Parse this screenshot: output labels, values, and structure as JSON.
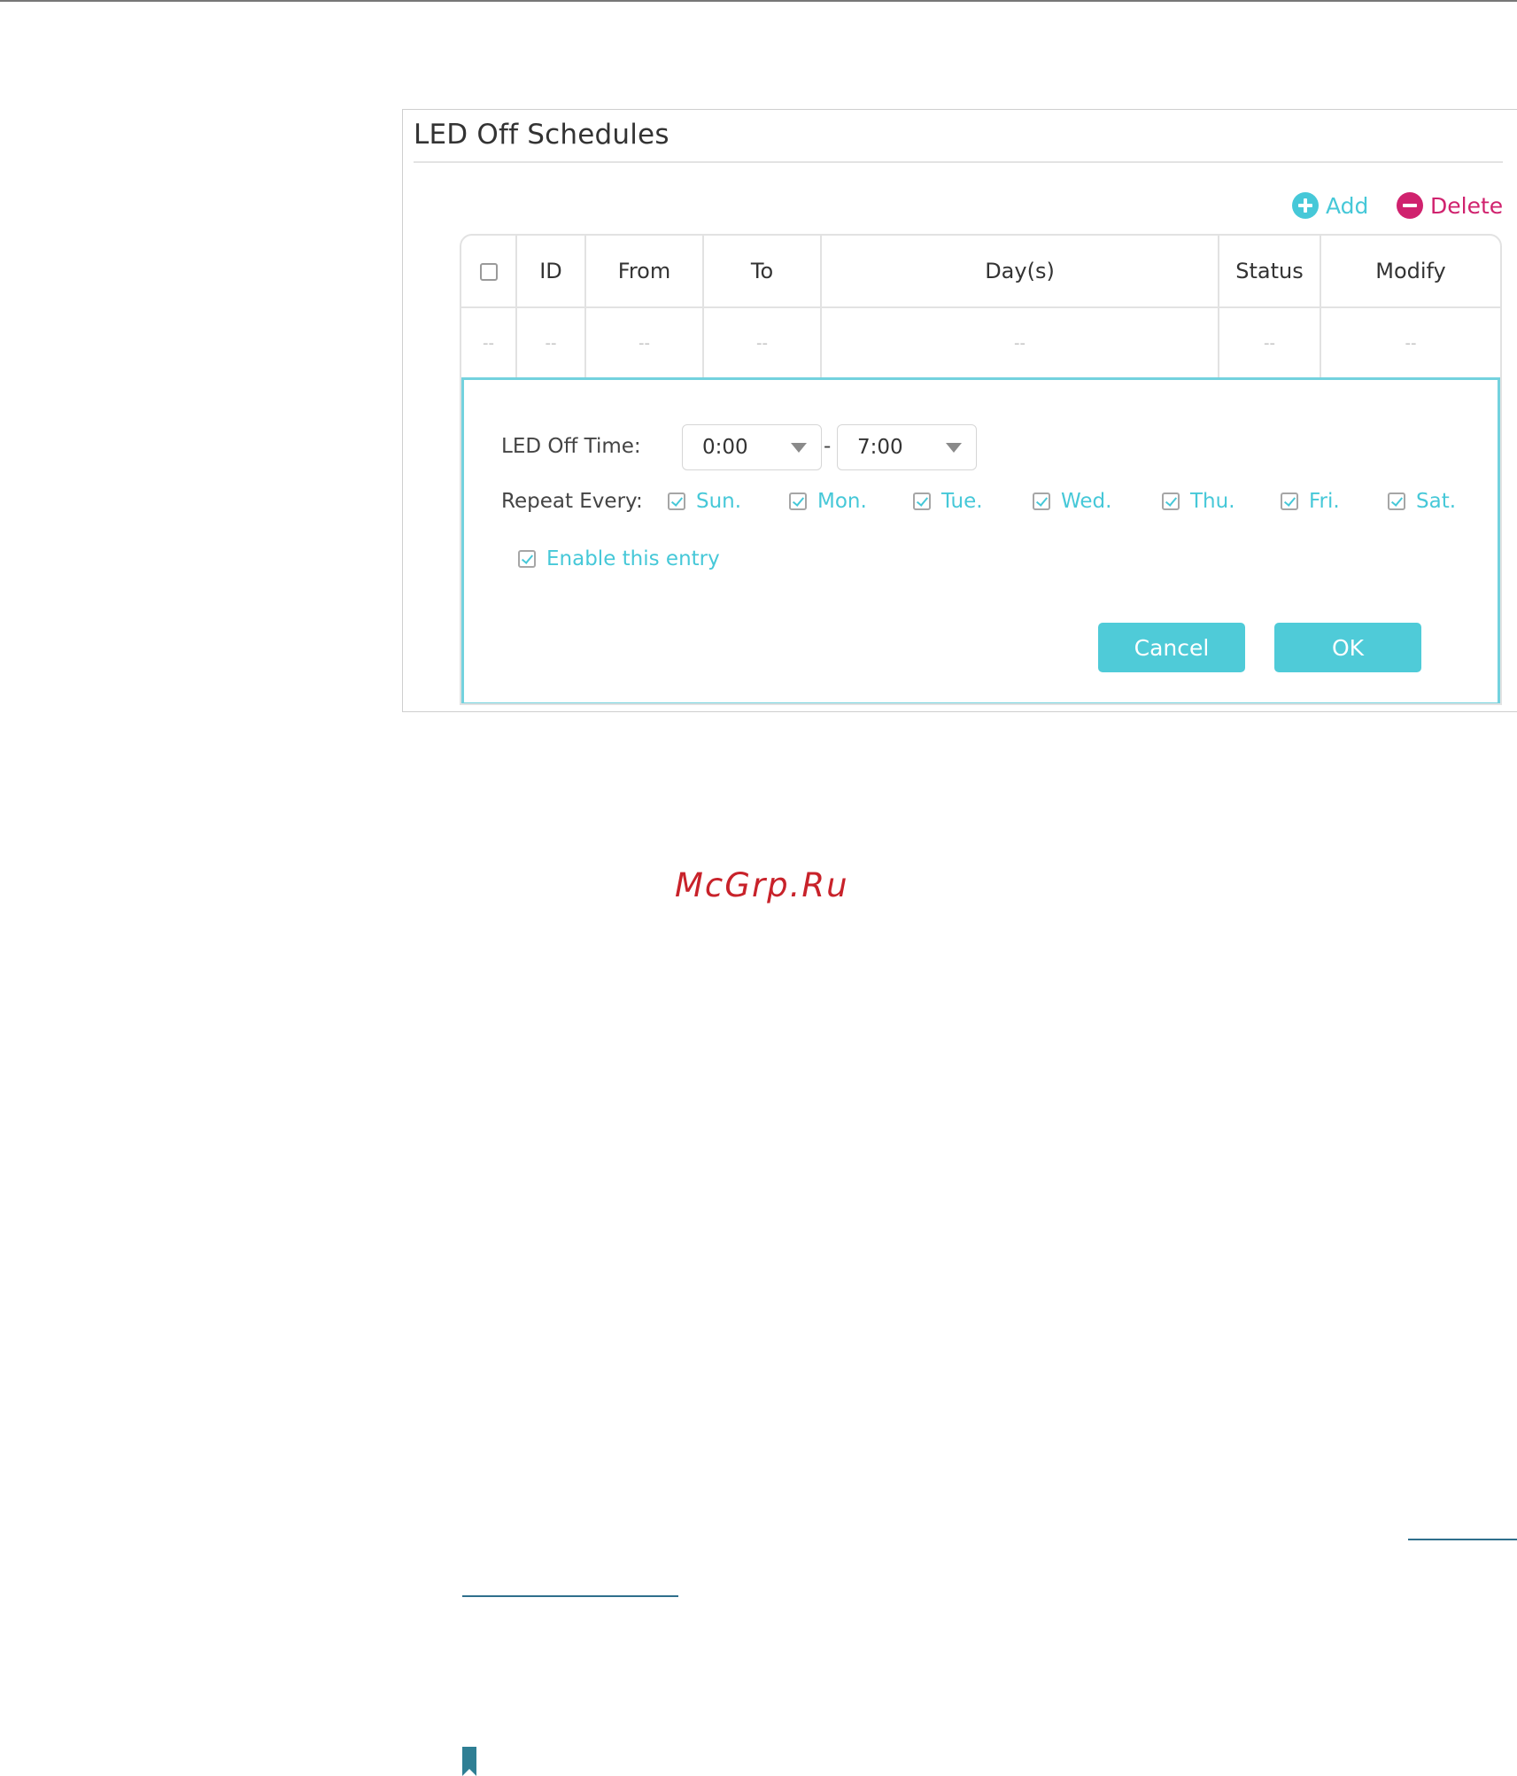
{
  "panel": {
    "title": "LED Off Schedules",
    "add_label": "Add",
    "delete_label": "Delete"
  },
  "table": {
    "headers": [
      "ID",
      "From",
      "To",
      "Day(s)",
      "Status",
      "Modify"
    ],
    "row": [
      "--",
      "--",
      "--",
      "--",
      "--",
      "--",
      "--"
    ]
  },
  "form": {
    "led_off_time_label": "LED Off Time:",
    "from_value": "0:00",
    "separator": "-",
    "to_value": "7:00",
    "repeat_label": "Repeat Every:",
    "days": [
      {
        "label": "Sun.",
        "checked": true
      },
      {
        "label": "Mon.",
        "checked": true
      },
      {
        "label": "Tue.",
        "checked": true
      },
      {
        "label": "Wed.",
        "checked": true
      },
      {
        "label": "Thu.",
        "checked": true
      },
      {
        "label": "Fri.",
        "checked": true
      },
      {
        "label": "Sat.",
        "checked": true
      }
    ],
    "enable_label": "Enable this entry",
    "enable_checked": true,
    "cancel_label": "Cancel",
    "ok_label": "OK"
  },
  "watermark": "McGrp.Ru",
  "colors": {
    "accent": "#46c8d8",
    "delete": "#d0226e",
    "button": "#4fcbd8",
    "watermark": "#c8222a"
  }
}
